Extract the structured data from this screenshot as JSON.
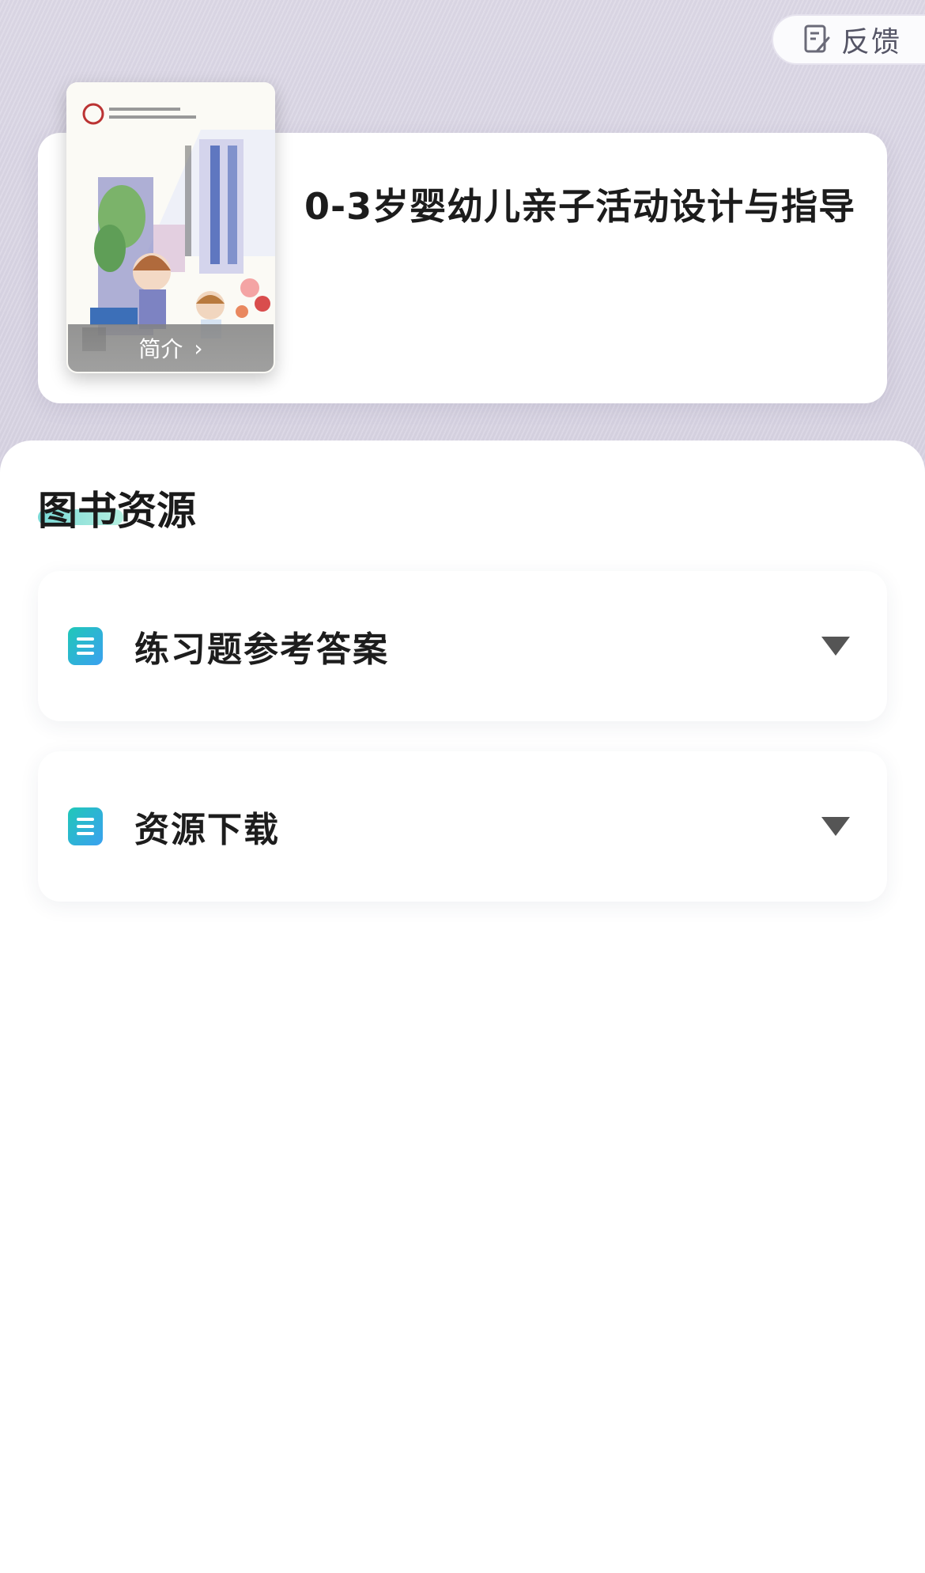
{
  "header": {
    "feedback_label": "反馈"
  },
  "book": {
    "title": "0-3岁婴幼儿亲子活动设计与指导",
    "intro_label": "简介"
  },
  "resources": {
    "section_title": "图书资源",
    "items": [
      {
        "label": "练习题参考答案",
        "icon": "document-icon",
        "expander": "caret-down-icon"
      },
      {
        "label": "资源下载",
        "icon": "document-icon",
        "expander": "caret-down-icon"
      }
    ]
  },
  "colors": {
    "hero_background": "#d9d5e4",
    "accent_gradient_start": "#20c8b8",
    "accent_gradient_end": "#3aa0f0",
    "text_primary": "#1d1d1d"
  }
}
